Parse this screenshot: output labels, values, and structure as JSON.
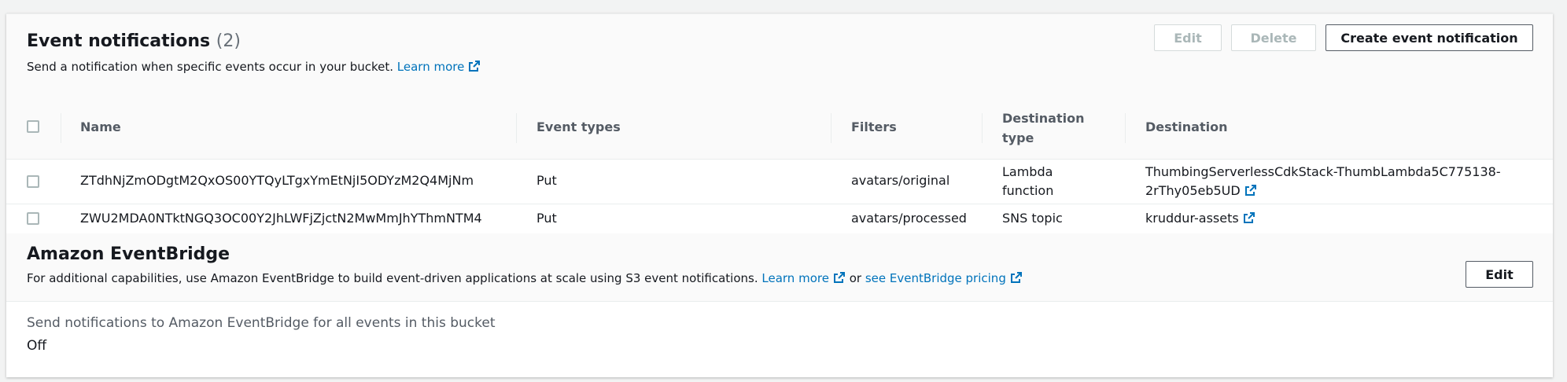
{
  "event_notifications": {
    "title": "Event notifications",
    "count": "(2)",
    "description": "Send a notification when specific events occur in your bucket.",
    "learn_more": "Learn more",
    "buttons": {
      "edit": "Edit",
      "delete": "Delete",
      "create": "Create event notification"
    },
    "columns": {
      "name": "Name",
      "event_types": "Event types",
      "filters": "Filters",
      "destination_type_line1": "Destination",
      "destination_type_line2": "type",
      "destination": "Destination"
    },
    "rows": [
      {
        "name": "ZTdhNjZmODgtM2QxOS00YTQyLTgxYmEtNjI5ODYzM2Q4MjNm",
        "event_types": "Put",
        "filters": "avatars/original",
        "destination_type_line1": "Lambda",
        "destination_type_line2": "function",
        "destination_line1": "ThumbingServerlessCdkStack-ThumbLambda5C775138-",
        "destination_line2": "2rThy05eb5UD"
      },
      {
        "name": "ZWU2MDA0NTktNGQ3OC00Y2JhLWFjZjctN2MwMmJhYThmNTM4",
        "event_types": "Put",
        "filters": "avatars/processed",
        "destination_type": "SNS topic",
        "destination": "kruddur-assets"
      }
    ]
  },
  "eventbridge": {
    "title": "Amazon EventBridge",
    "description_pre": "For additional capabilities, use Amazon EventBridge to build event-driven applications at scale using S3 event notifications.",
    "learn_more": "Learn more",
    "or": "or",
    "pricing_link": "see EventBridge pricing",
    "edit": "Edit",
    "setting_label": "Send notifications to Amazon EventBridge for all events in this bucket",
    "setting_value": "Off"
  },
  "colors": {
    "link": "#0073bb",
    "text": "#16191f",
    "muted": "#545b64",
    "disabled": "#aab7b8"
  }
}
